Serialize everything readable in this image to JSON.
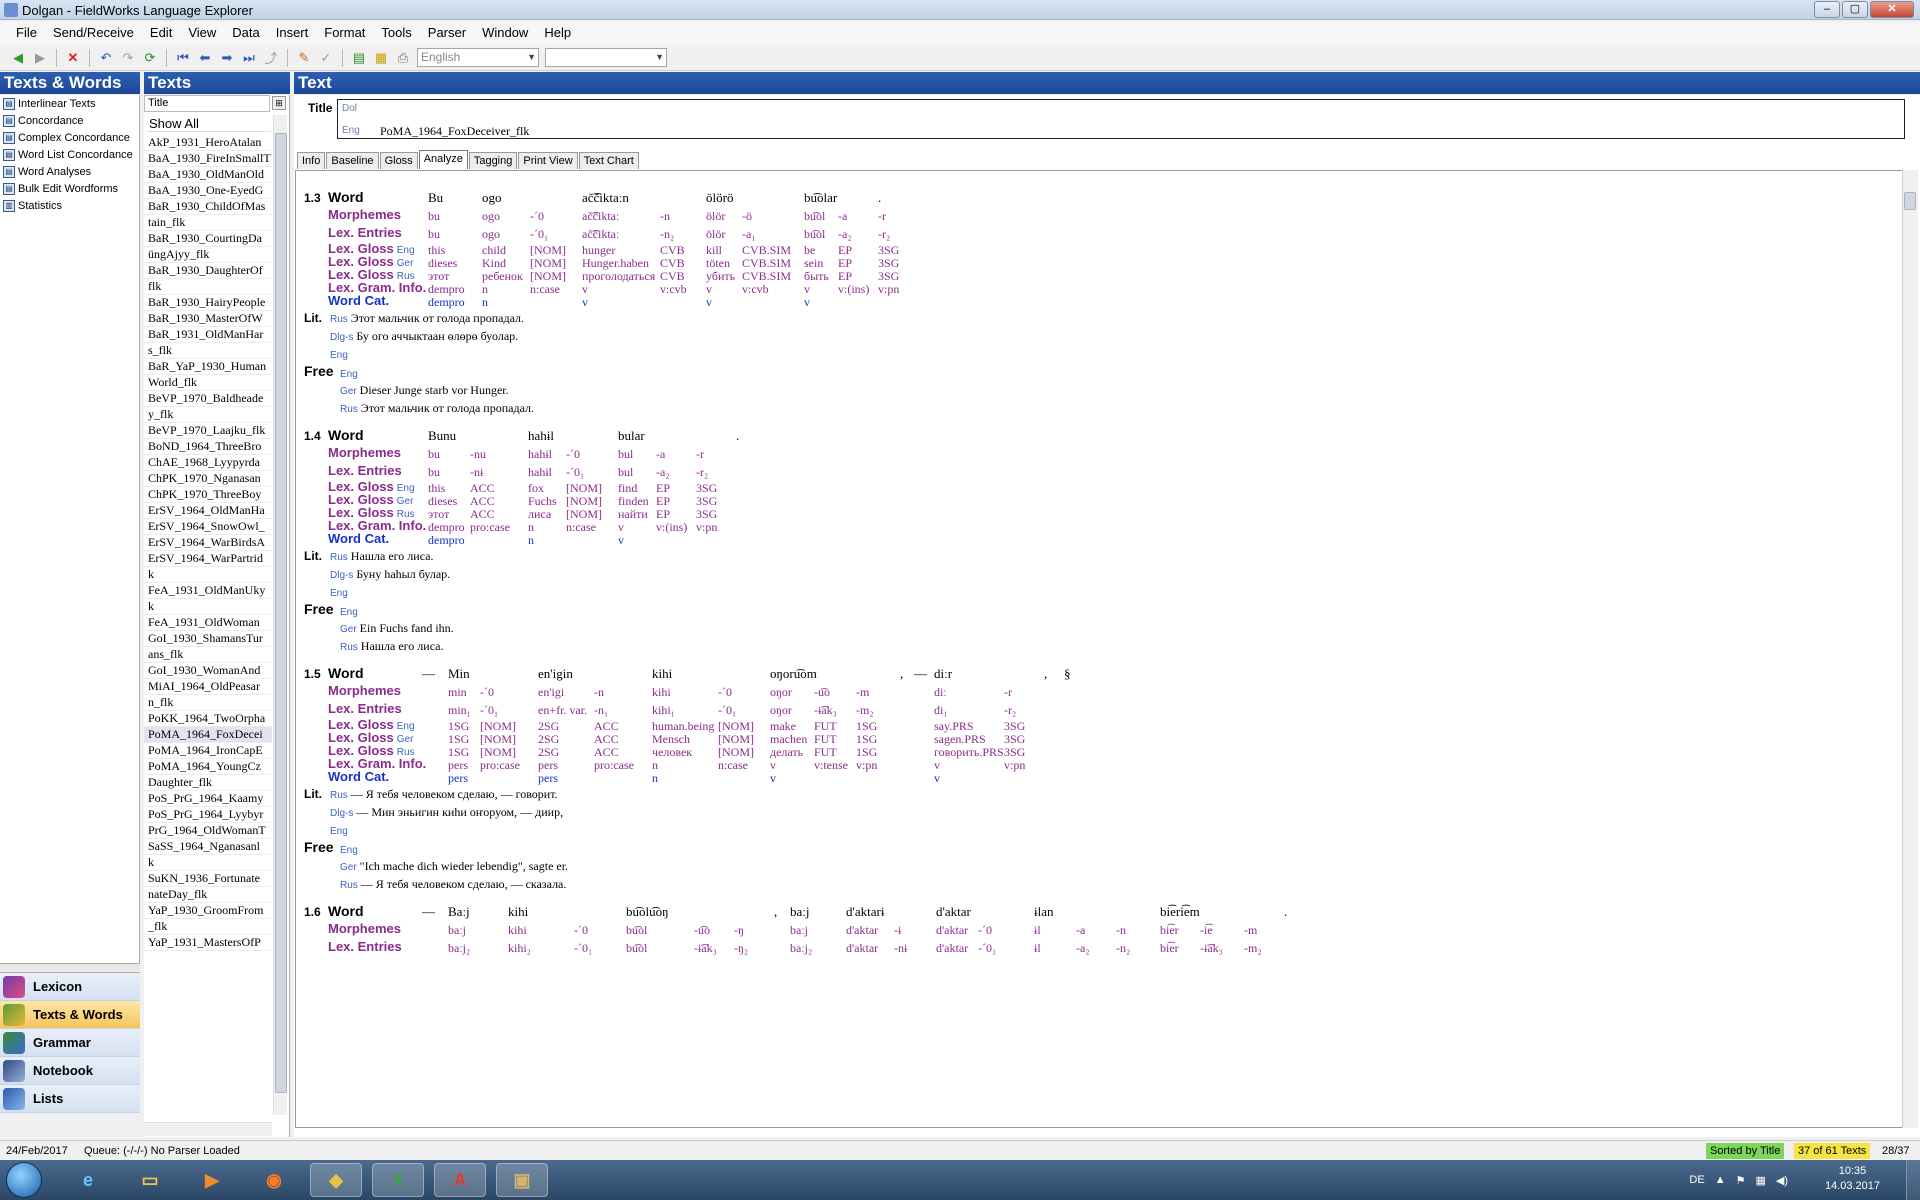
{
  "window": {
    "title": "Dolgan - FieldWorks Language Explorer",
    "min": "–",
    "max": "▢",
    "close": "✕"
  },
  "menu": [
    "File",
    "Send/Receive",
    "Edit",
    "View",
    "Data",
    "Insert",
    "Format",
    "Tools",
    "Parser",
    "Window",
    "Help"
  ],
  "toolbar": {
    "writing_system": "English",
    "style": ""
  },
  "left_pane": {
    "header": "Texts & Words",
    "items": [
      "Interlinear Texts",
      "Concordance",
      "Complex Concordance",
      "Word List Concordance",
      "Word Analyses",
      "Bulk Edit Wordforms",
      "Statistics"
    ]
  },
  "sidebar": {
    "buttons": [
      "Lexicon",
      "Texts & Words",
      "Grammar",
      "Notebook",
      "Lists"
    ]
  },
  "mid_pane": {
    "header": "Texts",
    "column": "Title",
    "show_all": "Show All",
    "items": [
      "AkP_1931_HeroAtalan",
      "BaA_1930_FireInSmallT",
      "BaA_1930_OldManOld",
      "BaA_1930_One-EyedG",
      "BaR_1930_ChildOfMas",
      "tain_flk",
      "BaR_1930_CourtingDa",
      "üngAjyy_flk",
      "BaR_1930_DaughterOf",
      "flk",
      "BaR_1930_HairyPeople",
      "BaR_1930_MasterOfW",
      "BaR_1931_OldManHar",
      "s_flk",
      "BaR_YaP_1930_Human",
      "World_flk",
      "BeVP_1970_Baldheade",
      "y_flk",
      "BeVP_1970_Laajku_flk",
      "BoND_1964_ThreeBro",
      "ChAE_1968_Lyypyrda",
      "ChPK_1970_Nganasan",
      "ChPK_1970_ThreeBoy",
      "ErSV_1964_OldManHa",
      "ErSV_1964_SnowOwl_",
      "ErSV_1964_WarBirdsA",
      "ErSV_1964_WarPartrid",
      "k",
      "FeA_1931_OldManUky",
      "k",
      "FeA_1931_OldWoman",
      "GoI_1930_ShamansTur",
      "ans_flk",
      "GoI_1930_WomanAnd",
      "MiAI_1964_OldPeasar",
      "n_flk",
      "PoKK_1964_TwoOrpha",
      "PoMA_1964_FoxDecei",
      "PoMA_1964_IronCapE",
      "PoMA_1964_YoungCz",
      "Daughter_flk",
      "PoS_PrG_1964_Kaamy",
      "PoS_PrG_1964_Lyybyr",
      "PrG_1964_OldWomanT",
      "SaSS_1964_Nganasanl",
      "k",
      "SuKN_1936_Fortunate",
      "nateDay_flk",
      "YaP_1930_GroomFrom",
      "_flk",
      "YaP_1931_MastersOfP"
    ],
    "selected_index": 37
  },
  "right_pane": {
    "header": "Text",
    "title_label": "Title",
    "title_ws1": "Dol",
    "title_ws2": "Eng",
    "title_value": "PoMA_1964_FoxDeceiver_flk",
    "tabs": [
      "Info",
      "Baseline",
      "Gloss",
      "Analyze",
      "Tagging",
      "Print View",
      "Text Chart"
    ],
    "active_tab": "Analyze"
  },
  "labels": {
    "word": "Word",
    "morphemes": "Morphemes",
    "lex_entries": "Lex. Entries",
    "lex_gloss": "Lex. Gloss",
    "lex_gram": "Lex. Gram. Info.",
    "word_cat": "Word Cat.",
    "lit": "Lit.",
    "free": "Free"
  },
  "segments": [
    {
      "no": "1.3",
      "word": [
        "Bu",
        "ogo",
        "",
        "ač͡čiktaːn",
        "",
        "ölörö",
        "",
        "bu͡olar",
        "",
        "."
      ],
      "morph": [
        "bu",
        "ogo",
        "-ˊ0",
        "ač͡čiktaː",
        "-n",
        "ölör",
        "-ö",
        "bu͡ol",
        "-a",
        "-r"
      ],
      "lex": [
        "bu",
        "ogo",
        "-ˊ0₁",
        "ač͡čiktaː",
        "-n₂",
        "ölör",
        "-a₁",
        "bu͡ol",
        "-a₂",
        "-r₂"
      ],
      "gloss_eng": [
        "this",
        "child",
        "[NOM]",
        "hunger",
        "CVB",
        "kill",
        "CVB.SIM",
        "be",
        "EP",
        "3SG"
      ],
      "gloss_ger": [
        "dieses",
        "Kind",
        "[NOM]",
        "Hunger.haben",
        "CVB",
        "töten",
        "CVB.SIM",
        "sein",
        "EP",
        "3SG"
      ],
      "gloss_rus": [
        "этот",
        "ребенок",
        "[NOM]",
        "проголодаться",
        "CVB",
        "убить",
        "CVB.SIM",
        "быть",
        "EP",
        "3SG"
      ],
      "gram": [
        "dempro",
        "n",
        "n:case",
        "v",
        "v:cvb",
        "v",
        "v:cvb",
        "v",
        "v:(ins)",
        "v:pn"
      ],
      "wcat": [
        "dempro",
        "n",
        "",
        "v",
        "",
        "v",
        "",
        "v",
        "",
        ""
      ],
      "lit_rus": "Этот мальчик от голода пропадал.",
      "lit_dlg": "Бу ого аччыктаан өлөрө буолар.",
      "free_ger": "Dieser Junge starb vor Hunger.",
      "free_rus": "Этот мальчик от голода пропадал."
    },
    {
      "no": "1.4",
      "word": [
        "Bunu",
        "",
        "hahɨl",
        "",
        "bular",
        "",
        "",
        "."
      ],
      "morph": [
        "bu",
        "-nu",
        "hahɨl",
        "-ˊ0",
        "bul",
        "-a",
        "-r",
        ""
      ],
      "lex": [
        "bu",
        "-nɨ",
        "hahɨl",
        "-ˊ0₁",
        "bul",
        "-a₂",
        "-r₂",
        ""
      ],
      "gloss_eng": [
        "this",
        "ACC",
        "fox",
        "[NOM]",
        "find",
        "EP",
        "3SG",
        ""
      ],
      "gloss_ger": [
        "dieses",
        "ACC",
        "Fuchs",
        "[NOM]",
        "finden",
        "EP",
        "3SG",
        ""
      ],
      "gloss_rus": [
        "этот",
        "ACC",
        "лиса",
        "[NOM]",
        "найти",
        "EP",
        "3SG",
        ""
      ],
      "gram": [
        "dempro",
        "pro:case",
        "n",
        "n:case",
        "v",
        "v:(ins)",
        "v:pn",
        ""
      ],
      "wcat": [
        "dempro",
        "",
        "n",
        "",
        "v",
        "",
        "",
        ""
      ],
      "lit_rus": "Нашла его лиса.",
      "lit_dlg": "Буну һаһыл булар.",
      "free_ger": "Ein Fuchs fand ihn.",
      "free_rus": "Нашла его лиса."
    },
    {
      "no": "1.5",
      "word": [
        "—",
        "Min",
        "",
        "en'igin",
        "",
        "kihi",
        "",
        "oŋoru͡om",
        "",
        "",
        ",",
        "—",
        "diːr",
        "",
        ",",
        "§"
      ],
      "morph": [
        "",
        "min",
        "-ˊ0",
        "en'igi",
        "-n",
        "kihi",
        "-ˊ0",
        "oŋor",
        "-u͡o",
        "-m",
        "",
        "",
        "diː",
        "-r",
        "",
        ""
      ],
      "lex": [
        "",
        "min₁",
        "-ˊ0₁",
        "en+fr. var.",
        "-n₁",
        "kihi₁",
        "-ˊ0₁",
        "oŋor",
        "-ɨ͡ak₃",
        "-m₂",
        "",
        "",
        "di₁",
        "-r₂",
        "",
        ""
      ],
      "gloss_eng": [
        "",
        "1SG",
        "[NOM]",
        "2SG",
        "ACC",
        "human.being",
        "[NOM]",
        "make",
        "FUT",
        "1SG",
        "",
        "",
        "say.PRS",
        "3SG",
        "",
        ""
      ],
      "gloss_ger": [
        "",
        "1SG",
        "[NOM]",
        "2SG",
        "ACC",
        "Mensch",
        "[NOM]",
        "machen",
        "FUT",
        "1SG",
        "",
        "",
        "sagen.PRS",
        "3SG",
        "",
        ""
      ],
      "gloss_rus": [
        "",
        "1SG",
        "[NOM]",
        "2SG",
        "ACC",
        "человек",
        "[NOM]",
        "делать",
        "FUT",
        "1SG",
        "",
        "",
        "говорить.PRS",
        "3SG",
        "",
        ""
      ],
      "gram": [
        "",
        "pers",
        "pro:case",
        "pers",
        "pro:case",
        "n",
        "n:case",
        "v",
        "v:tense",
        "v:pn",
        "",
        "",
        "v",
        "v:pn",
        "",
        ""
      ],
      "wcat": [
        "",
        "pers",
        "",
        "pers",
        "",
        "n",
        "",
        "v",
        "",
        "",
        "",
        "",
        "v",
        "",
        "",
        ""
      ],
      "lit_rus": "— Я тебя человеком сделаю, — говорит.",
      "lit_dlg": "— Мин эньигин киһи оҥоруом, — диир,",
      "free_ger": "\"Ich mache dich wieder lebendig\", sagte er.",
      "free_rus": "— Я тебя человеком сделаю, — сказала."
    },
    {
      "no": "1.6",
      "word": [
        "—",
        "Baːj",
        "kihi",
        "",
        "bu͡olu͡oŋ",
        "",
        "",
        ",",
        "baːj",
        "d'aktarɨ",
        "",
        "d'aktar",
        "",
        "ɨlan",
        "",
        "",
        "bi͡eri͡em",
        "",
        "",
        "."
      ],
      "morph": [
        "",
        "baːj",
        "kihi",
        "-ˊ0",
        "bu͡ol",
        "-u͡o",
        "-ŋ",
        "",
        "baːj",
        "d'aktar",
        "-ɨ",
        "d'aktar",
        "-ˊ0",
        "ɨl",
        "-a",
        "-n",
        "bi͡er",
        "-i͡e",
        "-m",
        ""
      ],
      "lex": [
        "",
        "baːj₂",
        "kihi₂",
        "-ˊ0₁",
        "bu͡ol",
        "-ɨ͡ak₃",
        "-ŋ₂",
        "",
        "baːj₂",
        "d'aktar",
        "-nɨ",
        "d'aktar",
        "-ˊ0₁",
        "ɨl",
        "-a₂",
        "-n₂",
        "bi͡er",
        "-ɨ͡ak₃",
        "-m₂",
        ""
      ]
    }
  ],
  "status": {
    "date": "24/Feb/2017",
    "queue": "Queue: (-/-/-) No Parser Loaded",
    "sorted": "Sorted by Title",
    "count": "37 of 61 Texts",
    "position": "28/37"
  },
  "taskbar": {
    "lang": "DE",
    "time": "10:35",
    "date": "14.03.2017"
  },
  "colors": {
    "header_blue": "#1c4797",
    "morph_purple": "#8b2b8b",
    "wordcat_blue": "#1633c7",
    "sorted_green": "#7cd65a",
    "count_yellow": "#f5e441"
  }
}
